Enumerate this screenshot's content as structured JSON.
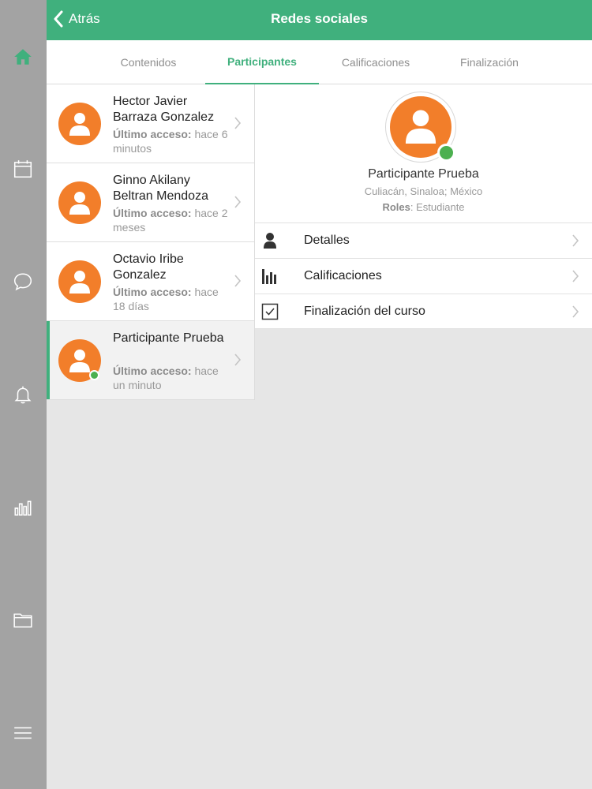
{
  "header": {
    "back_label": "Atrás",
    "title": "Redes sociales",
    "color": "#40b07d"
  },
  "rail": {
    "icons": [
      "home-icon",
      "calendar-icon",
      "chat-icon",
      "bell-icon",
      "bar-chart-icon",
      "folder-icon",
      "menu-icon"
    ]
  },
  "tabs": [
    {
      "label": "Contenidos",
      "active": false
    },
    {
      "label": "Participantes",
      "active": true
    },
    {
      "label": "Calificaciones",
      "active": false
    },
    {
      "label": "Finalización",
      "active": false
    }
  ],
  "participants": [
    {
      "name": "Hector Javier Barraza Gonzalez",
      "access_label": "Último acceso:",
      "access_value": "hace 6 minutos",
      "online": false,
      "selected": false
    },
    {
      "name": "Ginno Akilany Beltran Mendoza",
      "access_label": "Último acceso:",
      "access_value": "hace 2 meses",
      "online": false,
      "selected": false
    },
    {
      "name": "Octavio Iribe Gonzalez",
      "access_label": "Último acceso:",
      "access_value": "hace 18 días",
      "online": false,
      "selected": false
    },
    {
      "name": "Participante Prueba",
      "access_label": "Último acceso:",
      "access_value": "hace un minuto",
      "online": true,
      "selected": true
    }
  ],
  "detail": {
    "name": "Participante Prueba",
    "location": "Culiacán, Sinaloa; México",
    "roles_label": "Roles",
    "roles_value": ": Estudiante",
    "menu": [
      {
        "label": "Detalles",
        "icon": "person-icon"
      },
      {
        "label": "Calificaciones",
        "icon": "bar-chart-icon"
      },
      {
        "label": "Finalización del curso",
        "icon": "checkbox-icon"
      }
    ]
  }
}
